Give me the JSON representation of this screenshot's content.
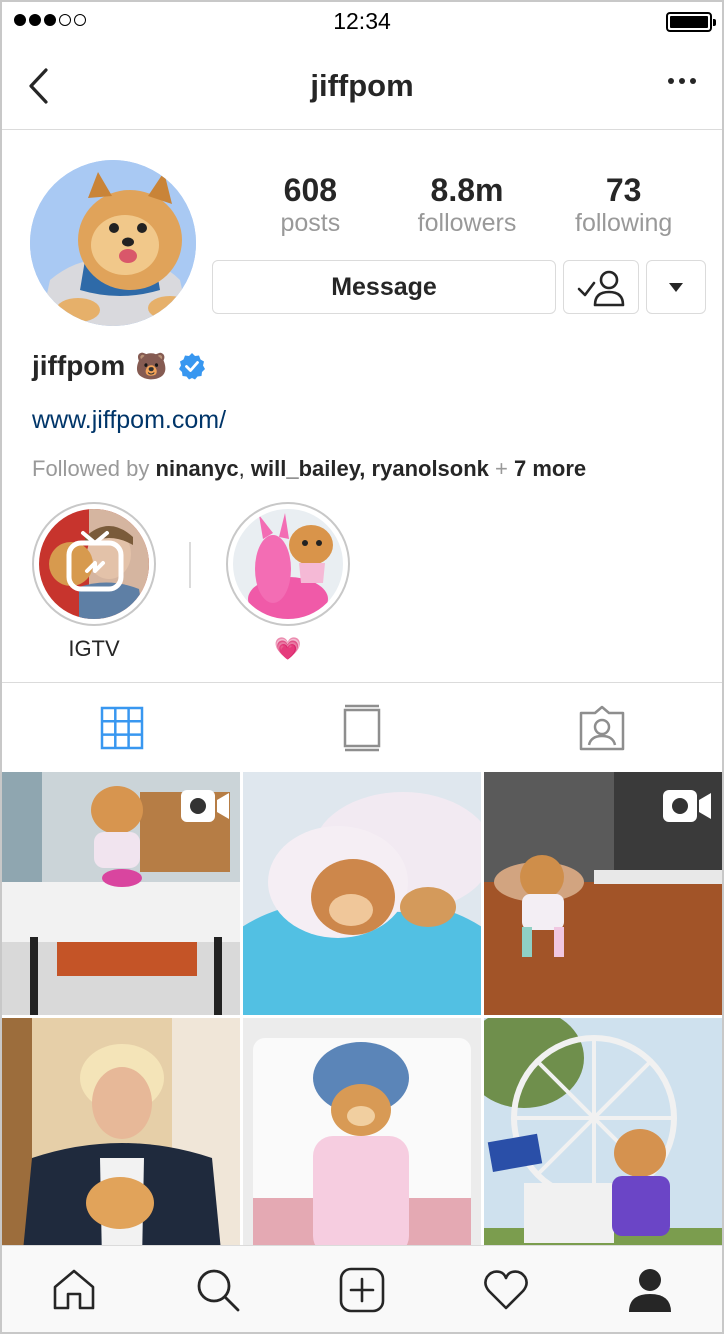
{
  "status_bar": {
    "time": "12:34"
  },
  "nav": {
    "title": "jiffpom"
  },
  "profile": {
    "stats": [
      {
        "value": "608",
        "label": "posts"
      },
      {
        "value": "8.8m",
        "label": "followers"
      },
      {
        "value": "73",
        "label": "following"
      }
    ],
    "message_label": "Message",
    "name": "jiffpom",
    "name_emoji": "🐻",
    "website": "www.jiffpom.com/",
    "followed_by_prefix": "Followed by ",
    "followed_by_users": "ninanyc",
    "followed_by_sep1": ", ",
    "followed_by_users2": "will_bailey, ryanolsonk",
    "followed_by_plus": " + ",
    "followed_by_more": "7 more"
  },
  "highlights": [
    {
      "label": "IGTV"
    },
    {
      "label": "💗"
    }
  ],
  "tabs": [
    "grid-icon",
    "feed-icon",
    "tagged-icon"
  ],
  "bottom_nav": [
    "home-icon",
    "search-icon",
    "new-post-icon",
    "activity-heart-icon",
    "profile-icon"
  ]
}
